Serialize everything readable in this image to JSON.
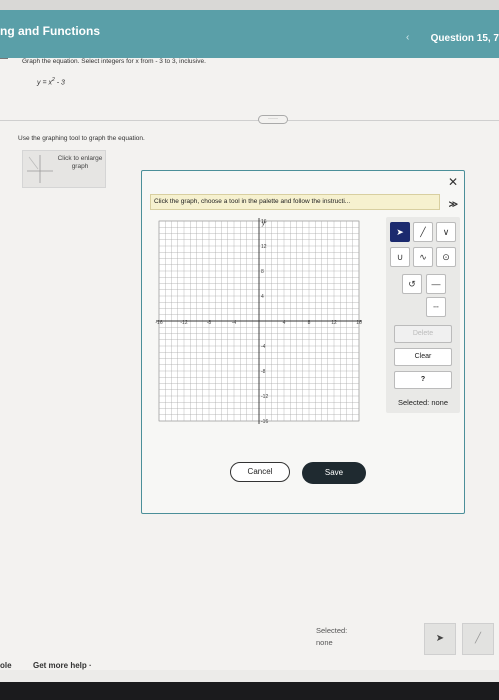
{
  "header": {
    "title": "ng and Functions",
    "question": "Question 15, 7",
    "prev_symbol": "‹"
  },
  "problem": {
    "instruction": "Graph the equation. Select integers for x from  - 3 to 3, inclusive.",
    "equation_lhs": "y = x",
    "equation_exp": "2",
    "equation_rhs": " - 3"
  },
  "more_pill": "·····",
  "tool_prompt": "Use the graphing tool to graph the equation.",
  "thumbnail": {
    "text": "Click to enlarge graph"
  },
  "dialog": {
    "close_symbol": "✕",
    "expand_symbol": "≫",
    "instruction": "Click the graph, choose a tool in the palette and follow the instructi...",
    "graph": {
      "y_axis_label": "y",
      "x_min": -16,
      "x_max": 16,
      "y_min": -16,
      "y_max": 16,
      "x_ticks": [
        "-16",
        "-12",
        "-8",
        "-4",
        "4",
        "8",
        "12",
        "16"
      ],
      "y_ticks": [
        "16",
        "12",
        "8",
        "4",
        "-4",
        "-8",
        "-12",
        "-16"
      ]
    },
    "palette": {
      "delete_label": "Delete",
      "clear_label": "Clear",
      "help_label": "?",
      "selected_text": "Selected: none"
    },
    "cancel_label": "Cancel",
    "save_label": "Save"
  },
  "bottom": {
    "selected_label": "Selected:",
    "selected_value": "none"
  },
  "footer": {
    "left_text": "ole",
    "help_text": "Get more help ·"
  },
  "colors": {
    "header": "#5a9fa8",
    "dialog_border": "#4b8f99",
    "save_button": "#1f2a30",
    "selected_tool": "#1b2a6e"
  }
}
